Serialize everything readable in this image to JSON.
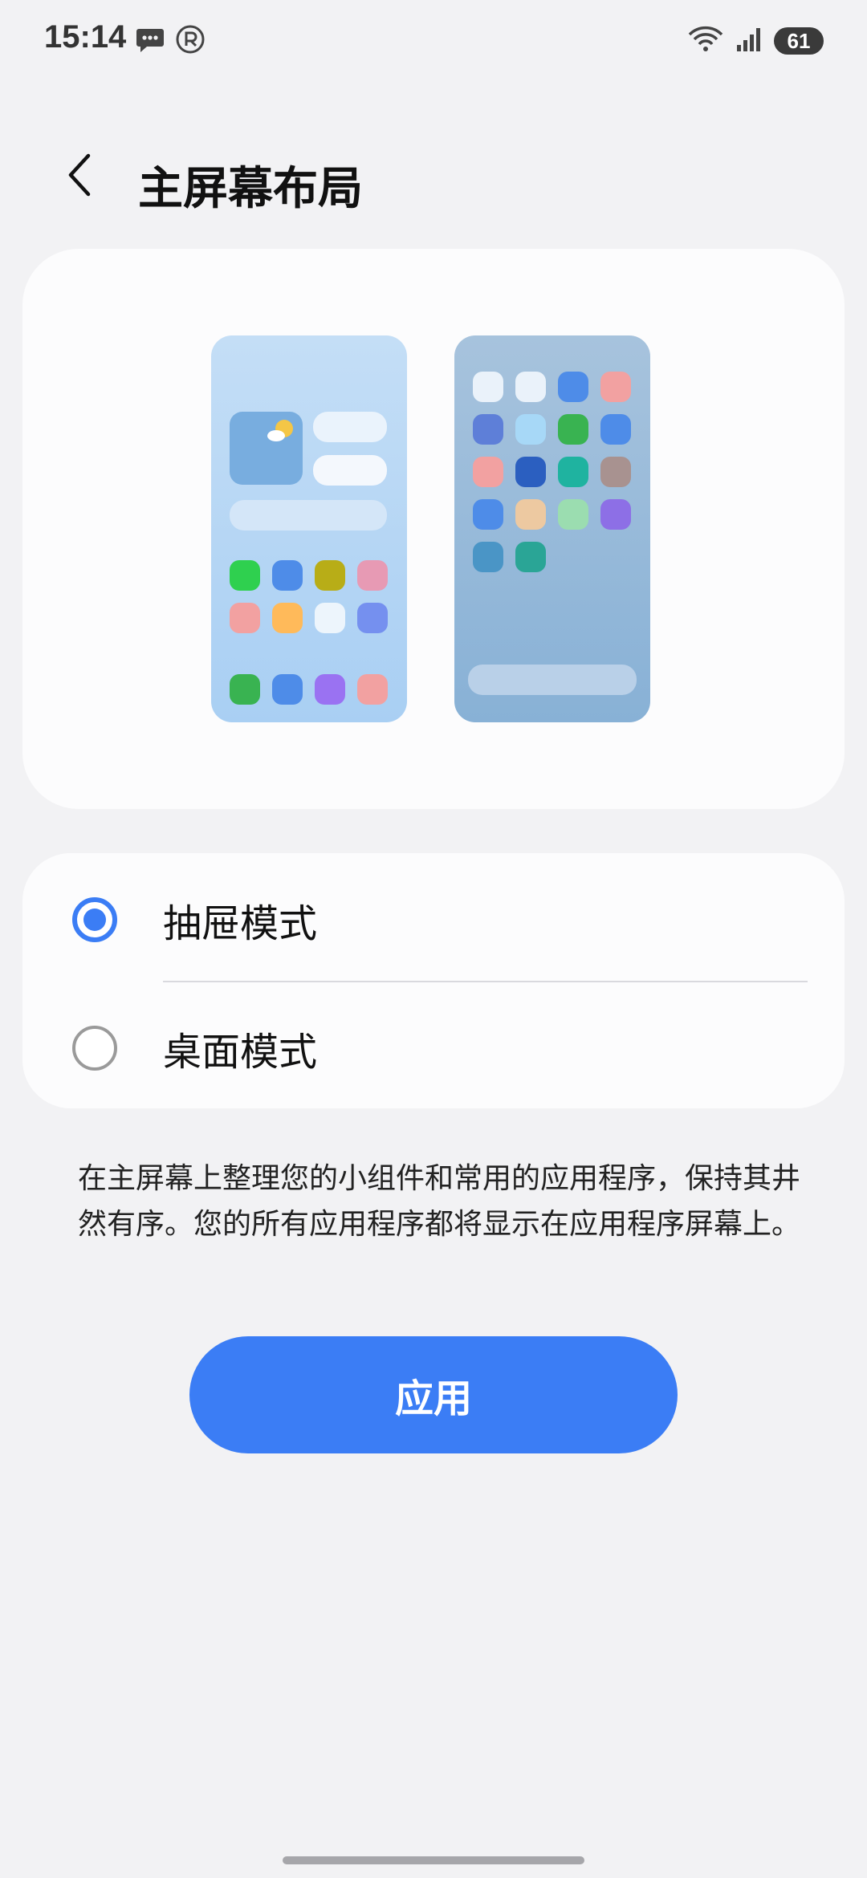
{
  "status_bar": {
    "time": "15:14",
    "battery": "61",
    "left_icons": [
      "message-icon",
      "registered-icon"
    ],
    "right_icons": [
      "wifi-icon",
      "signal-icon"
    ]
  },
  "header": {
    "title": "主屏幕布局",
    "back_icon": "chevron-left-icon"
  },
  "preview": {
    "left_phone_icon_colors": [
      "#2fd04f",
      "#4e8ce8",
      "#b8ad17",
      "#e79ab4",
      "#f2a1a1",
      "#ffba5a",
      "#edf5fc",
      "#7590ef"
    ],
    "left_phone_dock_colors": [
      "#39b351",
      "#4e8ce8",
      "#9a72f2",
      "#f2a1a1"
    ],
    "right_phone_icon_colors": [
      "#eaf2fa",
      "#eaf2fa",
      "#4e8ce8",
      "#f2a1a1",
      "#5e7fd8",
      "#a7d8f7",
      "#39b351",
      "#4e8ce8",
      "#f2a1a1",
      "#2b5fc0",
      "#1fb3a0",
      "#a89290",
      "#4e8ce8",
      "#edc9a1",
      "#9bddb0",
      "#8d6fe6",
      "#4a95c6",
      "#2aa596"
    ]
  },
  "options": [
    {
      "label": "抽屉模式",
      "selected": true
    },
    {
      "label": "桌面模式",
      "selected": false
    }
  ],
  "description": "在主屏幕上整理您的小组件和常用的应用程序，保持其井然有序。您的所有应用程序都将显示在应用程序屏幕上。",
  "apply_button": {
    "label": "应用"
  },
  "colors": {
    "accent": "#3b7df5",
    "background": "#f2f2f4",
    "card": "#fcfcfd"
  }
}
